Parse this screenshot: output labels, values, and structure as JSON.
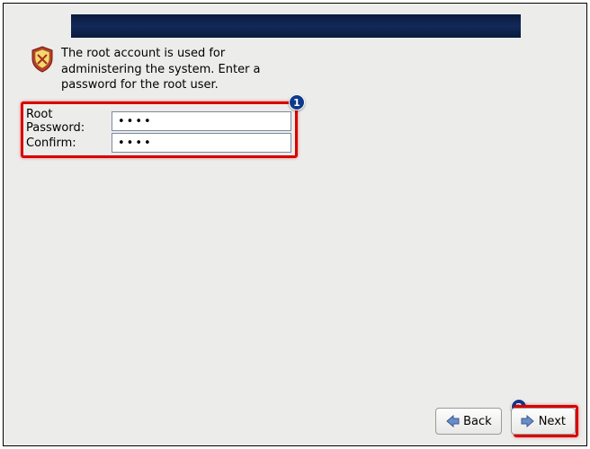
{
  "intro": {
    "text": "The root account is used for administering the system.  Enter a password for the root user."
  },
  "form": {
    "root_password_label": "Root Password:",
    "confirm_label": "Confirm:",
    "root_password_value": "••••",
    "confirm_value": "••••"
  },
  "callouts": {
    "one": "1",
    "two": "2"
  },
  "buttons": {
    "back_label": "Back",
    "next_label": "Next"
  },
  "icons": {
    "shield": "shield-icon",
    "arrow_left": "arrow-left-icon",
    "arrow_right": "arrow-right-icon"
  },
  "colors": {
    "highlight": "#d80000",
    "badge": "#0e3a8a",
    "header": "#122a5a"
  }
}
